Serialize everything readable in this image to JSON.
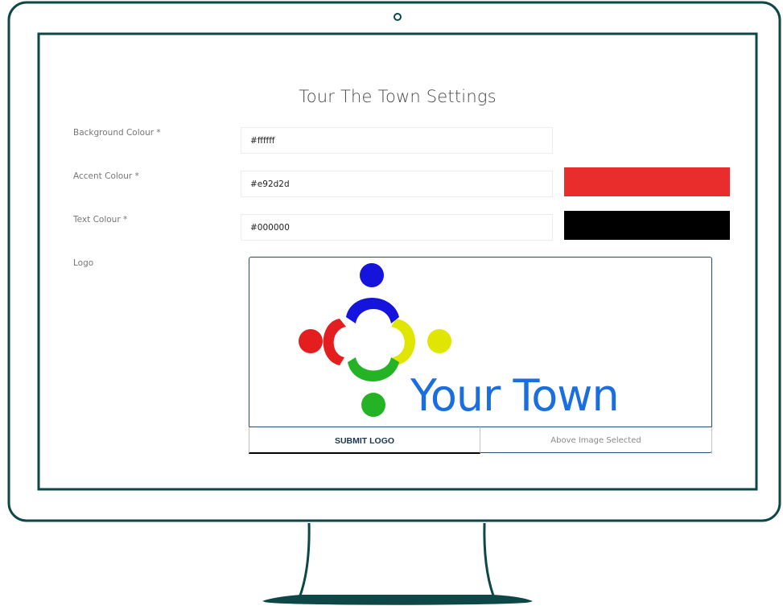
{
  "page": {
    "title": "Tour The Town Settings"
  },
  "fields": {
    "background": {
      "label": "Background Colour *",
      "value": "#ffffff"
    },
    "accent": {
      "label": "Accent Colour *",
      "value": "#e92d2d",
      "swatch_color": "#e92d2d"
    },
    "text": {
      "label": "Text Colour *",
      "value": "#000000",
      "swatch_color": "#000000"
    }
  },
  "logo": {
    "label": "Logo",
    "image_text": "Your Town",
    "submit_label": "SUBMIT LOGO",
    "status": "Above Image Selected",
    "figure_colors": [
      "#1414dc",
      "#e0e600",
      "#24b324",
      "#e41e1e"
    ]
  },
  "colors": {
    "frame": "#0d4747"
  }
}
